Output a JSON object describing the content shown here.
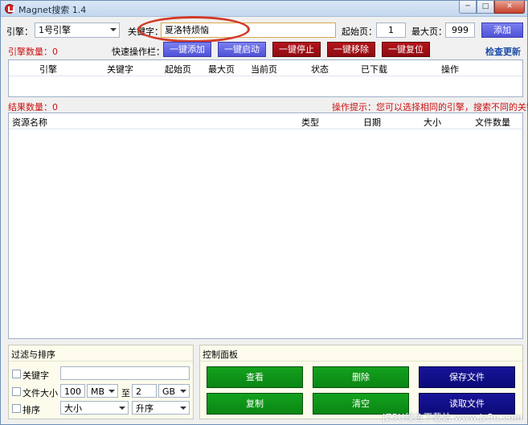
{
  "window": {
    "title": "Magnet搜索 1.4",
    "min": "─",
    "max": "□",
    "close": "✕"
  },
  "search": {
    "engine_label": "引擎：",
    "engine_value": "1号引擎",
    "keyword_label": "关键字：",
    "keyword_value": "夏洛特烦恼",
    "start_label": "起始页：",
    "start_value": "1",
    "max_label": "最大页：",
    "max_value": "999",
    "add_button": "添加"
  },
  "toolbar": {
    "engine_count": "引擎数量：0",
    "quick_label": "快速操作栏：",
    "add_all": "一键添加",
    "start_all": "一键启动",
    "stop_all": "一键停止",
    "remove_all": "一键移除",
    "reset_all": "一键复位",
    "check_update": "检查更新"
  },
  "engine_table": {
    "columns": [
      "引擎",
      "关键字",
      "起始页",
      "最大页",
      "当前页",
      "状态",
      "已下载",
      "操作"
    ]
  },
  "results": {
    "count": "结果数量：0",
    "hint": "操作提示：您可以选择相同的引擎，搜索不同的关键字",
    "columns": [
      "资源名称",
      "类型",
      "日期",
      "大小",
      "文件数量"
    ]
  },
  "filter": {
    "title": "过滤与排序",
    "keyword_label": "关键字",
    "keyword_value": "",
    "size_label": "文件大小",
    "size_min": "100",
    "size_min_unit": "MB",
    "size_to": "至",
    "size_max": "2",
    "size_max_unit": "GB",
    "sort_label": "排序",
    "sort_by": "大小",
    "sort_order": "升序"
  },
  "control": {
    "title": "控制面板",
    "view": "查看",
    "delete": "删除",
    "save_file": "保存文件",
    "copy": "复制",
    "clear": "清空",
    "read_file": "读取文件"
  },
  "watermark": "JZ5U绿色下载站 www.jz5u.com"
}
